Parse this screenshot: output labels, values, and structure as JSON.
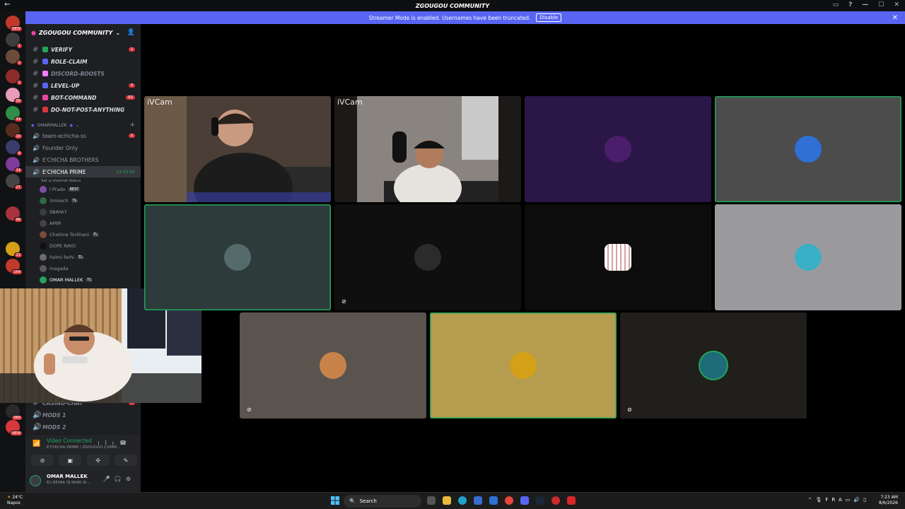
{
  "window": {
    "title": "ZGOUGOU COMMUNITY",
    "back": "←",
    "controls": [
      "▭",
      "?",
      "—",
      "☐",
      "✕"
    ]
  },
  "streamer_banner": {
    "text": "Streamer Mode is enabled. Usernames have been truncated.",
    "button": "Disable"
  },
  "server_list": {
    "badges": [
      "NEW",
      "1",
      "2",
      "2",
      "99",
      "44",
      "10",
      "8",
      "14",
      "27",
      "96",
      "23",
      "164",
      "984",
      "NEW"
    ]
  },
  "guild": {
    "name": "ZGOUGOU COMMUNITY"
  },
  "channels": [
    {
      "name": "VERIFY",
      "count": "1",
      "color": "#23a55a"
    },
    {
      "name": "ROLE-CLAIM",
      "count": "",
      "color": "#5865f2"
    },
    {
      "name": "DISCORD-BOOSTS",
      "count": "",
      "color": "#f47fff",
      "dim": true
    },
    {
      "name": "LEVEL-UP",
      "count": "3",
      "color": "#5865f2"
    },
    {
      "name": "BOT-COMMAND",
      "count": "92",
      "color": "#eb459e"
    },
    {
      "name": "DO-NOT-POST-ANYTHING",
      "count": "",
      "color": "#da373c"
    }
  ],
  "category": {
    "name": "OMARMALLEK"
  },
  "voice_channels": [
    {
      "name": "team-echicha-ss",
      "count": "2"
    },
    {
      "name": "Founder Only"
    },
    {
      "name": "E'CHICHA BROTHERS"
    },
    {
      "name": "E'CHICHA PRIME",
      "time": "13:33:42",
      "status": "Set a channel status"
    }
  ],
  "members": [
    {
      "name": "l Prado",
      "tag": "BEST"
    },
    {
      "name": "3mirech",
      "tag": "TL"
    },
    {
      "name": "9BAYA7",
      "tag": ""
    },
    {
      "name": "AMIR",
      "tag": ""
    },
    {
      "name": "Chahine Torkhani",
      "tag": "TL"
    },
    {
      "name": "DOPE RAYO",
      "tag": ""
    },
    {
      "name": "helmi ferhi",
      "tag": "TL"
    },
    {
      "name": "magada",
      "tag": ""
    },
    {
      "name": "OMAR MALLEK",
      "tag": "TL"
    }
  ],
  "lower_channels": [
    {
      "name": "CASINO-CHAT",
      "count": "4"
    },
    {
      "name": "MODS 1"
    },
    {
      "name": "MODS 2"
    }
  ],
  "voice_status": {
    "title": "Video Connected",
    "sub": "E'CHICHA PRIME / ZGOUGOU COMM..."
  },
  "user": {
    "name": "OMAR MALLEK",
    "status": "ELI BESNA YJI NHAR W ..."
  },
  "tiles": [
    {
      "label": "iVCam",
      "bg": "#3a3330",
      "speaking": false
    },
    {
      "label": "iVCam",
      "bg": "#2a2623",
      "speaking": false
    },
    {
      "label": "",
      "bg": "#2a1747",
      "speaking": false
    },
    {
      "label": "",
      "bg": "#4c4c4c",
      "speaking": true
    },
    {
      "label": "",
      "bg": "#2e3b3b",
      "speaking": true
    },
    {
      "label": "",
      "bg": "#0f0f0f",
      "speaking": false
    },
    {
      "label": "",
      "bg": "#0c0c0c",
      "speaking": false
    },
    {
      "label": "",
      "bg": "#9a9a9e",
      "speaking": false
    },
    {
      "label": "",
      "bg": "#5a544f",
      "speaking": false
    },
    {
      "label": "",
      "bg": "#b59c4e",
      "speaking": true
    },
    {
      "label": "",
      "bg": "#211f1b",
      "speaking": false
    }
  ],
  "taskbar": {
    "weather_temp": "24°C",
    "weather_place": "Napos",
    "search": "Search",
    "lang": "FRA",
    "time": "7:23 AM",
    "date": "8/6/2026"
  }
}
